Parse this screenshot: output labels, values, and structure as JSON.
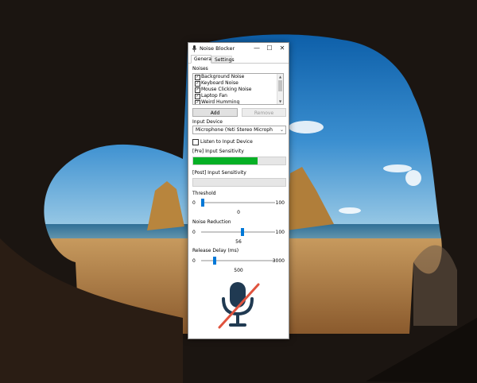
{
  "window": {
    "title": "Noise Blocker",
    "minimize_glyph": "—",
    "maximize_glyph": "☐",
    "close_glyph": "✕"
  },
  "tabs": [
    {
      "label": "General",
      "active": true
    },
    {
      "label": "Settings",
      "active": false
    }
  ],
  "noises": {
    "label": "Noises",
    "items": [
      {
        "label": "Background Noise",
        "checked": true
      },
      {
        "label": "Keyboard Noise",
        "checked": true
      },
      {
        "label": "Mouse Clicking Noise",
        "checked": true
      },
      {
        "label": "Laptop Fan",
        "checked": true
      },
      {
        "label": "Weird Humming",
        "checked": true
      }
    ],
    "add_label": "Add",
    "remove_label": "Remove"
  },
  "input_device": {
    "label": "Input Device",
    "selected": "Microphone (Yeti Stereo Microph",
    "listen_label": "Listen to Input Device",
    "listen_checked": false
  },
  "sensitivity": {
    "pre_label": "[Pre] Input Sensitivity",
    "pre_level": 0.7,
    "post_label": "[Post] Input Sensitivity",
    "post_level": 0
  },
  "threshold": {
    "label": "Threshold",
    "min": "0",
    "max": "100",
    "value": "0"
  },
  "noise_reduction": {
    "label": "Noise Reduction",
    "min": "0",
    "max": "100",
    "value": "56"
  },
  "release_delay": {
    "label": "Release Delay (ms)",
    "min": "0",
    "max": "3000",
    "value": "500"
  },
  "colors": {
    "accent": "#0078d7",
    "meter_fill": "#06b025",
    "mic_icon": "#203a52",
    "mute_slash": "#e0533e"
  },
  "icons": {
    "app": "microphone-icon",
    "status": "microphone-muted-icon"
  }
}
